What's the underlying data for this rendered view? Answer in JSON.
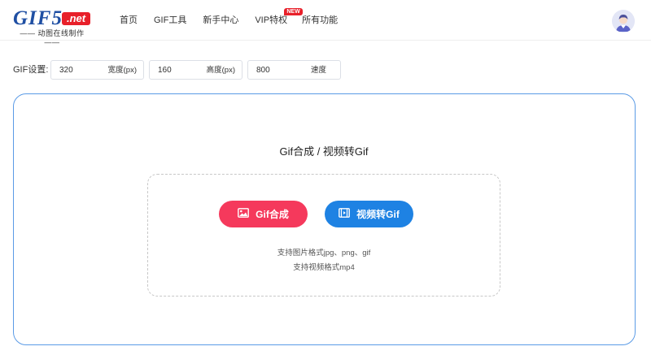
{
  "logo": {
    "main": "GIF5",
    "badge": ".net",
    "tagline": "—— 动图在线制作 ——"
  },
  "nav": {
    "items": [
      {
        "label": "首页"
      },
      {
        "label": "GIF工具"
      },
      {
        "label": "新手中心"
      },
      {
        "label": "VIP特权",
        "badge": "NEW"
      },
      {
        "label": "所有功能"
      }
    ]
  },
  "settings": {
    "label": "GIF设置:",
    "width": {
      "value": "320",
      "suffix": "宽度(px)"
    },
    "height": {
      "value": "160",
      "suffix": "高度(px)"
    },
    "speed": {
      "value": "800",
      "suffix": "速度"
    }
  },
  "main": {
    "title": "Gif合成 / 视频转Gif",
    "gif_button": "Gif合成",
    "video_button": "视频转Gif",
    "hint_image": "支持图片格式jpg、png、gif",
    "hint_video": "支持视频格式mp4"
  },
  "colors": {
    "brand_blue": "#1f4fa3",
    "brand_red": "#e8202a",
    "gif_button": "#f5395c",
    "video_button": "#1e82e3",
    "card_border": "#5b9be6"
  },
  "icons": {
    "gif_button": "image-icon",
    "video_button": "film-icon",
    "avatar": "user-avatar-icon"
  }
}
